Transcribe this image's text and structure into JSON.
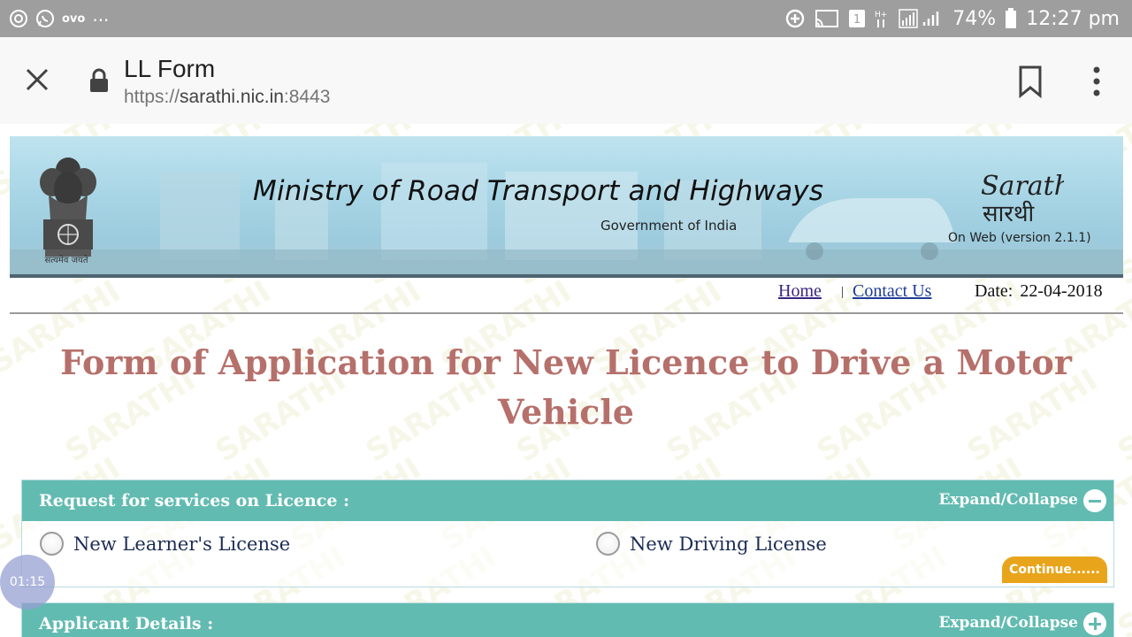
{
  "status_bar": {
    "left_app_label": "ovo",
    "more": "...",
    "battery": "74%",
    "time": "12:27 pm",
    "sim_number": "1"
  },
  "toolbar": {
    "title": "LL Form",
    "url_scheme": "https://",
    "url_host": "sarathi.nic.in",
    "url_port": ":8443"
  },
  "banner": {
    "ministry": "Ministry of Road Transport and Highways",
    "government": "Government of India",
    "emblem_motto": "सत्यमेव जयते",
    "logo_name": "Sarathi",
    "logo_hindi": "सारथी",
    "version": "On Web (version 2.1.1)"
  },
  "nav": {
    "home": "Home",
    "separator": "|",
    "contact": "Contact Us",
    "date_label": "Date:",
    "date_value": "22-04-2018"
  },
  "form_title": "Form of Application for New Licence to Drive a Motor Vehicle",
  "watermark_text": "SARATHI",
  "panels": [
    {
      "title": "Request for services on Licence :",
      "toggle": "Expand/Collapse",
      "state": "expanded",
      "options": [
        "New Learner's License",
        "New Driving License"
      ],
      "continue": "Continue......"
    },
    {
      "title": "Applicant Details :",
      "toggle": "Expand/Collapse",
      "state": "collapsed"
    }
  ],
  "overlay_timer": "01:15",
  "colors": {
    "panel_header": "#62bbb1",
    "title": "#b6706b",
    "continue": "#e8a51c",
    "status_bar": "#9e9e9e"
  }
}
